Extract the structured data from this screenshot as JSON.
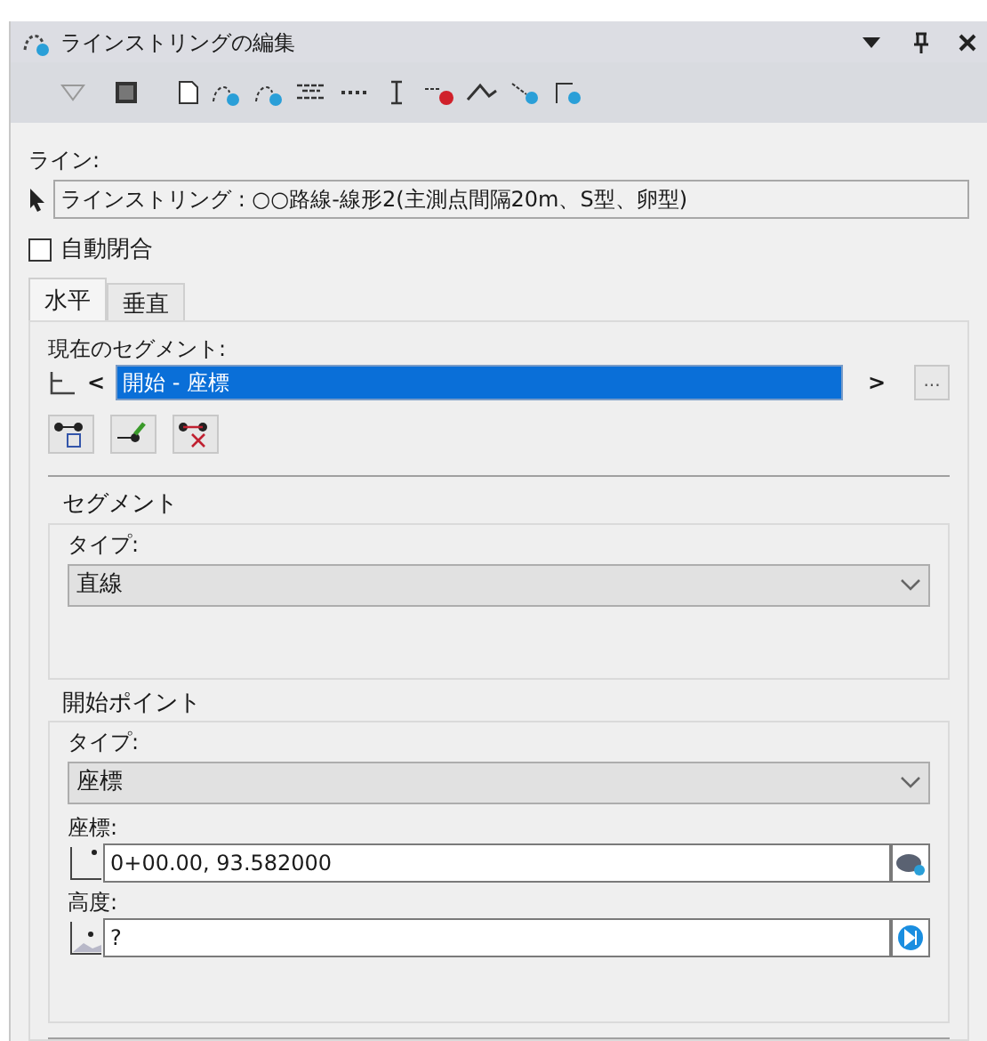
{
  "window": {
    "title": "ラインストリングの編集"
  },
  "line": {
    "label": "ライン:",
    "value": "ラインストリング : ○○路線-線形2(主測点間隔20m、S型、卵型)"
  },
  "auto_close": {
    "label": "自動閉合",
    "checked": false
  },
  "tabs": [
    {
      "label": "水平",
      "selected": true
    },
    {
      "label": "垂直",
      "selected": false
    }
  ],
  "current_segment": {
    "label": "現在のセグメント:",
    "prev": "<",
    "value": "開始 - 座標",
    "next": ">",
    "more": "..."
  },
  "segment_group": {
    "title": "セグメント",
    "type_label": "タイプ:",
    "type_value": "直線"
  },
  "start_point_group": {
    "title": "開始ポイント",
    "type_label": "タイプ:",
    "type_value": "座標",
    "coord_label": "座標:",
    "coord_value": "0+00.00, 93.582000",
    "elev_label": "高度:",
    "elev_value": "?"
  }
}
